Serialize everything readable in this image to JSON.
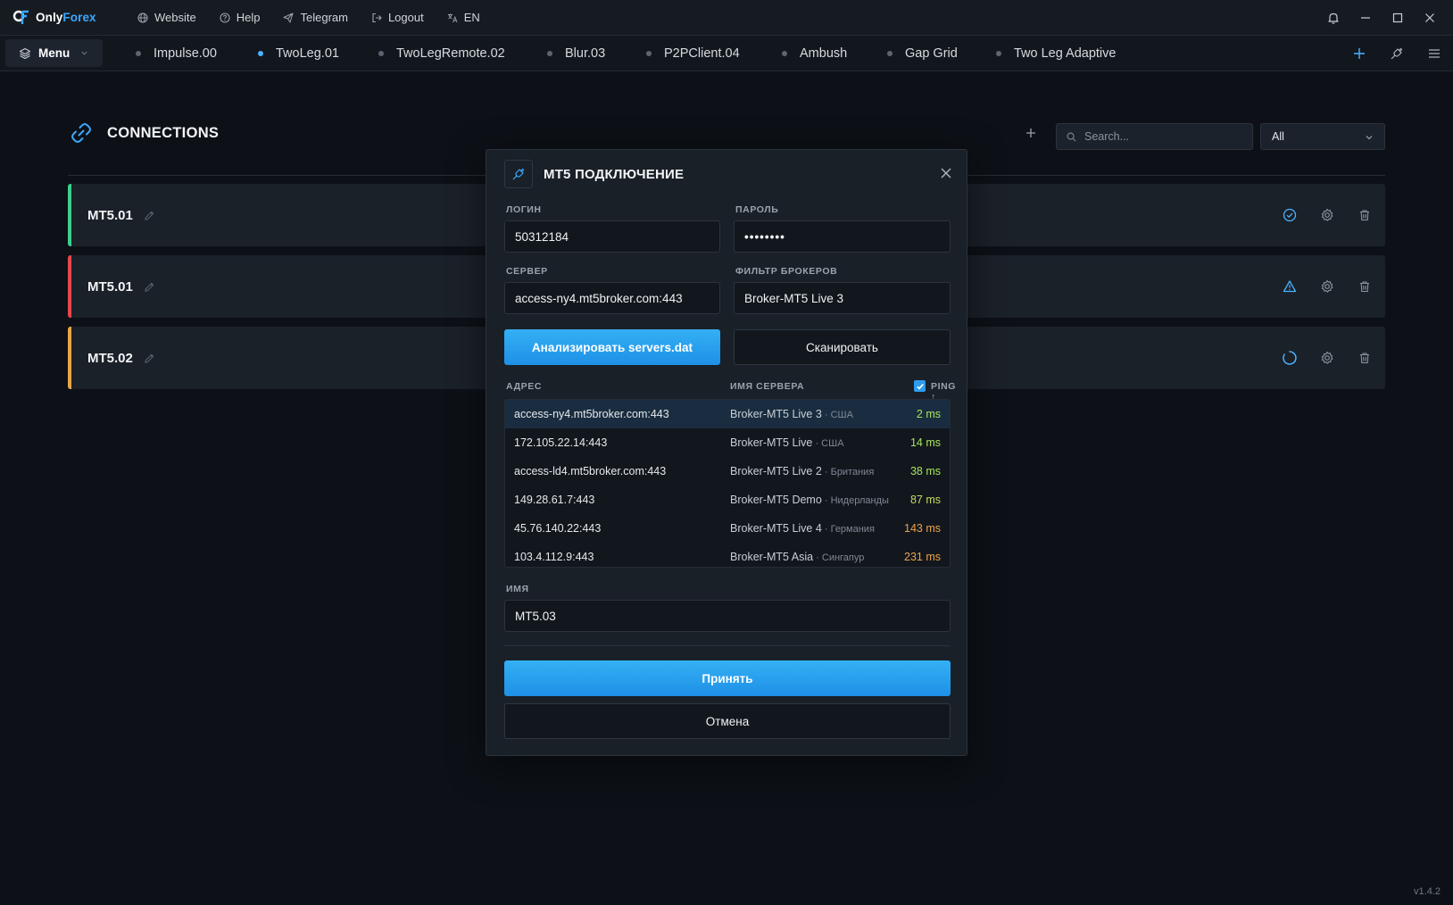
{
  "app": {
    "brand_prefix": "Only",
    "brand_suffix": "Forex",
    "version": "v1.4.2"
  },
  "topnav": {
    "website": "Website",
    "help": "Help",
    "telegram": "Telegram",
    "logout": "Logout",
    "language": "EN"
  },
  "tabsbar": {
    "menu_label": "Menu",
    "tabs": [
      {
        "label": "Impulse.00",
        "active": false
      },
      {
        "label": "TwoLeg.01",
        "active": true
      },
      {
        "label": "TwoLegRemote.02",
        "active": false
      },
      {
        "label": "Blur.03",
        "active": false
      },
      {
        "label": "P2PClient.04",
        "active": false
      },
      {
        "label": "Ambush",
        "active": false
      },
      {
        "label": "Gap Grid",
        "active": false
      },
      {
        "label": "Two Leg Adaptive",
        "active": false
      }
    ]
  },
  "connections": {
    "title": "CONNECTIONS",
    "search_placeholder": "Search...",
    "filter_value": "All",
    "rows": [
      {
        "name": "MT5.01",
        "status": "connected",
        "accent": "#3ecf8e"
      },
      {
        "name": "MT5.01",
        "status": "warning",
        "accent": "#e5484d"
      },
      {
        "name": "MT5.02",
        "status": "loading",
        "accent": "#e8a54b"
      }
    ]
  },
  "modal": {
    "title": "MT5 ПОДКЛЮЧЕНИЕ",
    "login_label": "ЛОГИН",
    "login_value": "50312184",
    "password_label": "ПАРОЛЬ",
    "password_value": "••••••••",
    "server_label": "СЕРВЕР",
    "server_value": "access-ny4.mt5broker.com:443",
    "broker_filter_label": "ФИЛЬТР БРОКЕРОВ",
    "broker_filter_value": "Broker-MT5 Live 3",
    "analyze_button": "Анализировать servers.dat",
    "scan_button": "Сканировать",
    "col_address": "АДРЕС",
    "col_server_name": "ИМЯ СЕРВЕРА",
    "col_ping": "PING ↑",
    "ping_sort_checked": true,
    "servers": [
      {
        "address": "access-ny4.mt5broker.com:443",
        "name": "Broker-MT5 Live 3",
        "country": "США",
        "ping": "2 ms",
        "ping_color": "#a6e35a",
        "selected": true
      },
      {
        "address": "172.105.22.14:443",
        "name": "Broker-MT5 Live",
        "country": "США",
        "ping": "14 ms",
        "ping_color": "#a6e35a",
        "selected": false
      },
      {
        "address": "access-ld4.mt5broker.com:443",
        "name": "Broker-MT5 Live 2",
        "country": "Британия",
        "ping": "38 ms",
        "ping_color": "#a6e35a",
        "selected": false
      },
      {
        "address": "149.28.61.7:443",
        "name": "Broker-MT5 Demo",
        "country": "Нидерланды",
        "ping": "87 ms",
        "ping_color": "#c6dc5e",
        "selected": false
      },
      {
        "address": "45.76.140.22:443",
        "name": "Broker-MT5 Live 4",
        "country": "Германия",
        "ping": "143 ms",
        "ping_color": "#eda34a",
        "selected": false
      },
      {
        "address": "103.4.112.9:443",
        "name": "Broker-MT5 Asia",
        "country": "Сингапур",
        "ping": "231 ms",
        "ping_color": "#eda34a",
        "selected": false
      }
    ],
    "name_label": "ИМЯ",
    "name_value": "MT5.03",
    "accept_button": "Принять",
    "cancel_button": "Отмена"
  }
}
